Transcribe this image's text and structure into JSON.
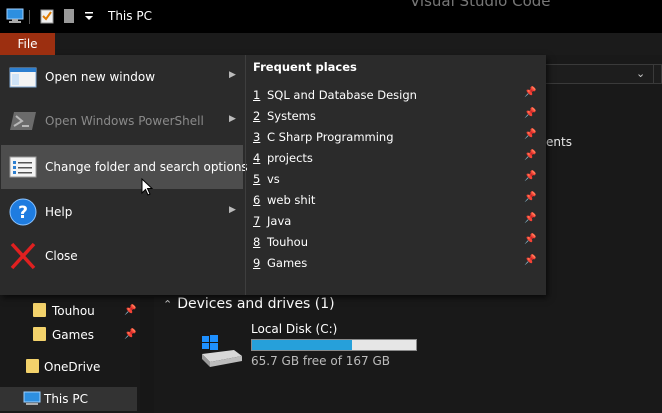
{
  "window": {
    "title": "This PC",
    "ghost_title": "Visual Studio Code"
  },
  "ribbon": {
    "file_tab": "File"
  },
  "file_menu": {
    "items": [
      {
        "label": "Open new window",
        "disabled": false,
        "has_submenu": true,
        "icon": "window-icon"
      },
      {
        "label": "Open Windows PowerShell",
        "disabled": true,
        "has_submenu": true,
        "icon": "powershell-icon"
      },
      {
        "label": "Change folder and search options",
        "disabled": false,
        "has_submenu": false,
        "icon": "options-icon"
      },
      {
        "label": "Help",
        "disabled": false,
        "has_submenu": true,
        "icon": "help-icon"
      },
      {
        "label": "Close",
        "disabled": false,
        "has_submenu": false,
        "icon": "close-icon"
      }
    ],
    "frequent_places": {
      "heading": "Frequent places",
      "items": [
        {
          "num": "1",
          "label": "SQL and Database Design"
        },
        {
          "num": "2",
          "label": "Systems"
        },
        {
          "num": "3",
          "label": "C Sharp Programming"
        },
        {
          "num": "4",
          "label": "projects"
        },
        {
          "num": "5",
          "label": "vs"
        },
        {
          "num": "6",
          "label": "web shit"
        },
        {
          "num": "7",
          "label": "Java"
        },
        {
          "num": "8",
          "label": "Touhou"
        },
        {
          "num": "9",
          "label": "Games"
        }
      ]
    }
  },
  "background": {
    "partial_text": "ents"
  },
  "nav": {
    "items": [
      {
        "label": "Touhou",
        "pinned": true
      },
      {
        "label": "Games",
        "pinned": true
      },
      {
        "label": "OneDrive"
      },
      {
        "label": "This PC",
        "selected": true
      }
    ]
  },
  "devices": {
    "heading": "Devices and drives (1)",
    "drive": {
      "name": "Local Disk (C:)",
      "free_text": "65.7 GB free of 167 GB",
      "used_fraction": 0.607
    }
  },
  "colors": {
    "accent": "#9c2f10",
    "drive_bar": "#26a0da",
    "menu_bg": "#2b2b2b",
    "hover_bg": "#4d4d4d"
  }
}
